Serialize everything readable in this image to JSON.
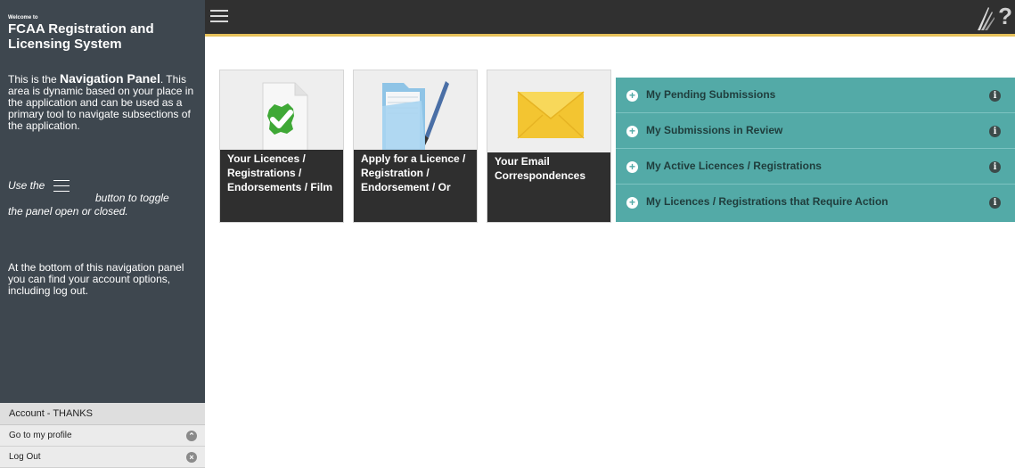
{
  "sidebar": {
    "welcome": "Welcome to",
    "title": "FCAA Registration and Licensing System",
    "intro_prefix": "This is the ",
    "intro_highlight": "Navigation Panel",
    "intro_suffix": ". This area is dynamic based on your place in the application and can be used as a primary tool to navigate subsections of the application.",
    "toggle_before": "Use the",
    "toggle_after": "button to toggle",
    "toggle_line2": "the panel open or closed.",
    "bottom_text": "At the bottom of this navigation panel you can find your account options, including log out."
  },
  "account": {
    "header": "Account - THANKS",
    "items": [
      {
        "label": "Go to my profile",
        "icon": "chevron-up-icon",
        "glyph": "⌃"
      },
      {
        "label": "Log Out",
        "icon": "close-icon",
        "glyph": "×"
      }
    ]
  },
  "topbar": {
    "help": "?"
  },
  "tiles": [
    {
      "label": "Your Licences / Registrations / Endorsements / Film",
      "icon": "document-check-icon"
    },
    {
      "label": "Apply for a Licence / Registration / Endorsement / Or",
      "icon": "folder-pen-icon"
    },
    {
      "label": "Your Email Correspondences",
      "icon": "envelope-icon"
    }
  ],
  "panel": {
    "color": "#53aaa7",
    "rows": [
      {
        "label": "My Pending Submissions",
        "plus": "+",
        "info": "i"
      },
      {
        "label": "My Submissions in Review",
        "plus": "+",
        "info": "i"
      },
      {
        "label": "My Active Licences / Registrations",
        "plus": "+",
        "info": "i"
      },
      {
        "label": "My Licences / Registrations that Require Action",
        "plus": "+",
        "info": "i"
      }
    ]
  }
}
